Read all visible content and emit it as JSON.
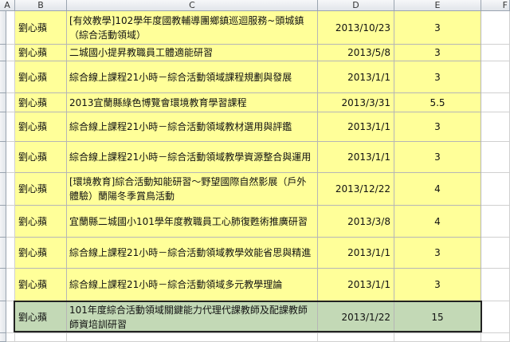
{
  "columns": [
    "A",
    "B",
    "C",
    "D",
    "E",
    "F"
  ],
  "rows": [
    {
      "name": "劉心蘋",
      "title": "[有效教學]102學年度國教輔導團鄉鎮巡迴服務~頭城鎮（綜合活動領域）",
      "date": "2013/10/23",
      "value": "3"
    },
    {
      "name": "劉心蘋",
      "title": "二城國小提昇教職員工體適能研習",
      "date": "2013/5/8",
      "value": "3"
    },
    {
      "name": "劉心蘋",
      "title": "綜合線上課程21小時－綜合活動領域課程規劃與發展",
      "date": "2013/1/1",
      "value": "3"
    },
    {
      "name": "劉心蘋",
      "title": "2013宜蘭縣綠色博覽會環境教育學習課程",
      "date": "2013/3/31",
      "value": "5.5"
    },
    {
      "name": "劉心蘋",
      "title": "綜合線上課程21小時－綜合活動領域教材選用與評鑑",
      "date": "2013/1/1",
      "value": "3"
    },
    {
      "name": "劉心蘋",
      "title": "綜合線上課程21小時－綜合活動領域教學資源整合與運用",
      "date": "2013/1/1",
      "value": "3"
    },
    {
      "name": "劉心蘋",
      "title": "[環境教育]綜合活動知能研習～野望國際自然影展（戶外體驗）蘭陽冬季賞鳥活動",
      "date": "2013/12/22",
      "value": "4"
    },
    {
      "name": "劉心蘋",
      "title": "宜蘭縣二城國小101學年度教職員工心肺復甦術推廣研習",
      "date": "2013/3/8",
      "value": "4"
    },
    {
      "name": "劉心蘋",
      "title": "綜合線上課程21小時－綜合活動領域教學效能省思與精進",
      "date": "2013/1/1",
      "value": "3"
    },
    {
      "name": "劉心蘋",
      "title": "綜合線上課程21小時－綜合活動領域多元教學理論",
      "date": "2013/1/1",
      "value": "3"
    },
    {
      "name": "劉心蘋",
      "title": "101年度綜合活動領域關鍵能力代理代課教師及配課教師師資培訓研習",
      "date": "2013/1/22",
      "value": "15"
    }
  ],
  "colors": {
    "cell_fill": "#ffff99",
    "selected_fill": "#c3d9b6",
    "grid": "#b6b6b6"
  }
}
